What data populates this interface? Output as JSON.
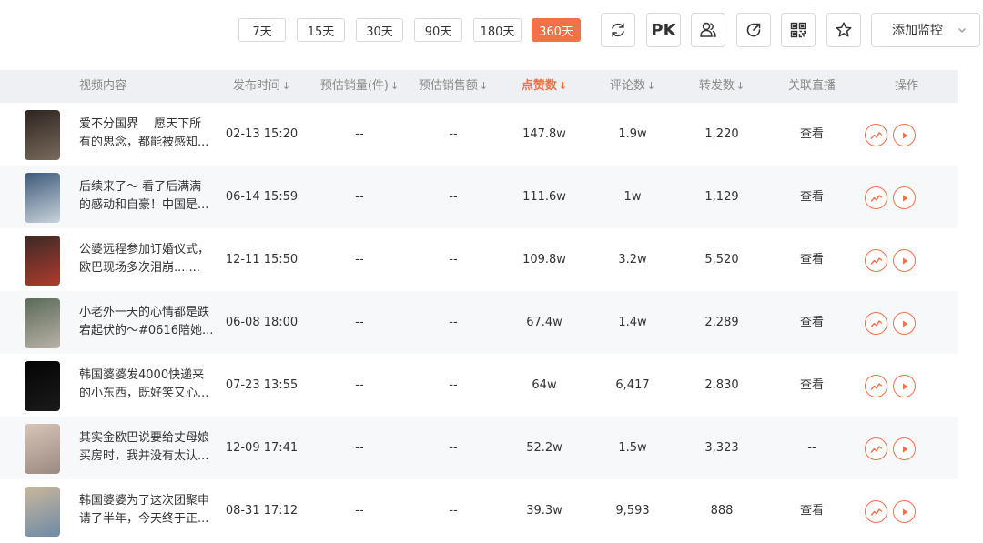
{
  "toolbar": {
    "ranges": [
      {
        "label": "7天",
        "active": false
      },
      {
        "label": "15天",
        "active": false
      },
      {
        "label": "30天",
        "active": false
      },
      {
        "label": "90天",
        "active": false
      },
      {
        "label": "180天",
        "active": false
      },
      {
        "label": "360天",
        "active": true
      }
    ],
    "pk_label": "PK",
    "monitor_label": "添加监控",
    "icons": [
      "refresh-icon",
      "users-icon",
      "share-icon",
      "qrcode-icon",
      "star-icon",
      "chevron-down-icon"
    ]
  },
  "table": {
    "headers": {
      "content": "视频内容",
      "time": "发布时间",
      "est_sales": "预估销量(件)",
      "est_amount": "预估销售额",
      "likes": "点赞数",
      "comments": "评论数",
      "shares": "转发数",
      "live": "关联直播",
      "actions": "操作"
    },
    "sort_arrow": "↓",
    "active_sort": "likes",
    "accent_color": "#f0714a",
    "rows": [
      {
        "title1": "爱不分国界　 愿天下所",
        "title2": "有的思念，都能被感知...",
        "time": "02-13 15:20",
        "est_sales": "--",
        "est_amount": "--",
        "likes": "147.8w",
        "comments": "1.9w",
        "shares": "1,220",
        "live": "查看"
      },
      {
        "title1": "后续来了～ 看了后满满",
        "title2": "的感动和自豪！中国是...",
        "time": "06-14 15:59",
        "est_sales": "--",
        "est_amount": "--",
        "likes": "111.6w",
        "comments": "1w",
        "shares": "1,129",
        "live": "查看"
      },
      {
        "title1": "公婆远程参加订婚仪式，",
        "title2": "欧巴现场多次泪崩.......",
        "time": "12-11 15:50",
        "est_sales": "--",
        "est_amount": "--",
        "likes": "109.8w",
        "comments": "3.2w",
        "shares": "5,520",
        "live": "查看"
      },
      {
        "title1": "小老外一天的心情都是跌",
        "title2": "宕起伏的～#0616陪她...",
        "time": "06-08 18:00",
        "est_sales": "--",
        "est_amount": "--",
        "likes": "67.4w",
        "comments": "1.4w",
        "shares": "2,289",
        "live": "查看"
      },
      {
        "title1": "韩国婆婆发4000快递来",
        "title2": "的小东西，既好笑又心...",
        "time": "07-23 13:55",
        "est_sales": "--",
        "est_amount": "--",
        "likes": "64w",
        "comments": "6,417",
        "shares": "2,830",
        "live": "查看"
      },
      {
        "title1": "其实金欧巴说要给丈母娘",
        "title2": "买房时，我并没有太认...",
        "time": "12-09 17:41",
        "est_sales": "--",
        "est_amount": "--",
        "likes": "52.2w",
        "comments": "1.5w",
        "shares": "3,323",
        "live": "--"
      },
      {
        "title1": "韩国婆婆为了这次团聚申",
        "title2": "请了半年，今天终于正...",
        "time": "08-31 17:12",
        "est_sales": "--",
        "est_amount": "--",
        "likes": "39.3w",
        "comments": "9,593",
        "shares": "888",
        "live": "查看"
      }
    ]
  }
}
